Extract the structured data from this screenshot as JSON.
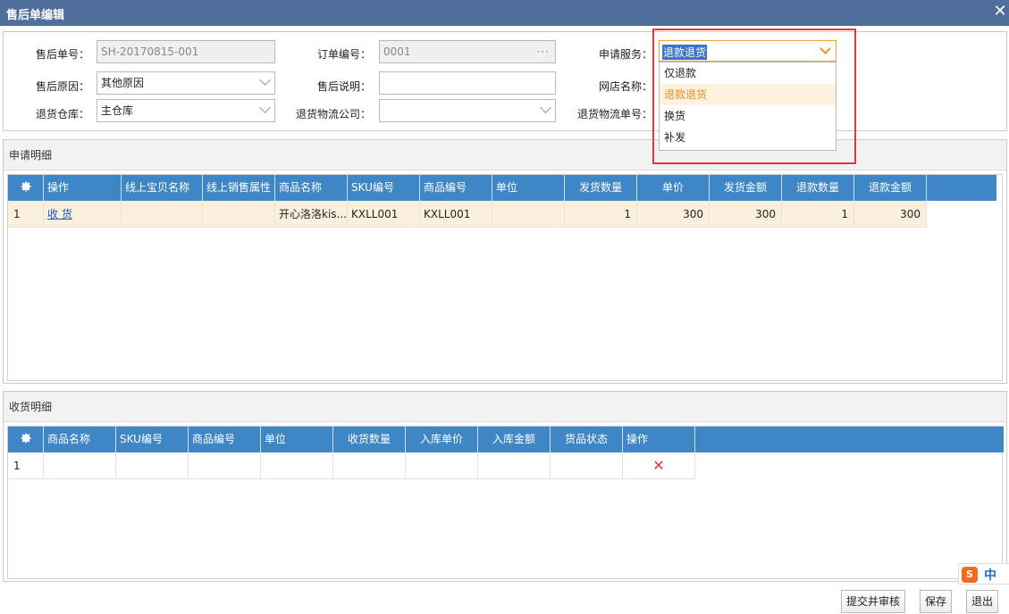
{
  "window": {
    "title": "售后单编辑",
    "close_glyph": "✕"
  },
  "form": {
    "after_sale_no_label": "售后单号：",
    "after_sale_no_value": "SH-20170815-001",
    "order_no_label": "订单编号：",
    "order_no_value": "0001",
    "apply_service_label": "申请服务：",
    "apply_service_value": "退款退货",
    "reason_label": "售后原因：",
    "reason_value": "其他原因",
    "remark_label": "售后说明：",
    "remark_value": "",
    "shop_label": "网店名称：",
    "warehouse_label": "退货仓库：",
    "warehouse_value": "主仓库",
    "logistics_label": "退货物流公司：",
    "logistics_value": "",
    "logistics_no_label": "退货物流单号："
  },
  "service_options": [
    "仅退款",
    "退款退货",
    "换货",
    "补发"
  ],
  "service_selected_index": 1,
  "apply_section": {
    "title": "申请明细",
    "columns": [
      "操作",
      "线上宝贝名称",
      "线上销售属性",
      "商品名称",
      "SKU编号",
      "商品编号",
      "单位",
      "发货数量",
      "单价",
      "发货金额",
      "退款数量",
      "退款金额"
    ],
    "rows": [
      {
        "index": "1",
        "action": "收 货",
        "online_name": "",
        "online_attr": "",
        "product_name": "开心洛洛kis...",
        "sku": "KXLL001",
        "product_code": "KXLL001",
        "unit": "",
        "ship_qty": "1",
        "price": "300",
        "ship_amount": "300",
        "refund_qty": "1",
        "refund_amount": "300"
      }
    ]
  },
  "receive_section": {
    "title": "收货明细",
    "columns": [
      "商品名称",
      "SKU编号",
      "商品编号",
      "单位",
      "收货数量",
      "入库单价",
      "入库金额",
      "货品状态",
      "操作"
    ],
    "rows": [
      {
        "index": "1",
        "delete_glyph": "✕"
      }
    ]
  },
  "buttons": {
    "submit_review": "提交并审核",
    "save": "保存",
    "exit": "退出"
  },
  "ime": {
    "logo": "S",
    "lang": "中"
  },
  "colors": {
    "title_bar": "#4f6f9a",
    "grid_header": "#3f86c6",
    "highlight_row": "#fbf0de",
    "highlight_border": "#e8343c",
    "accent_orange": "#f08c1f"
  }
}
